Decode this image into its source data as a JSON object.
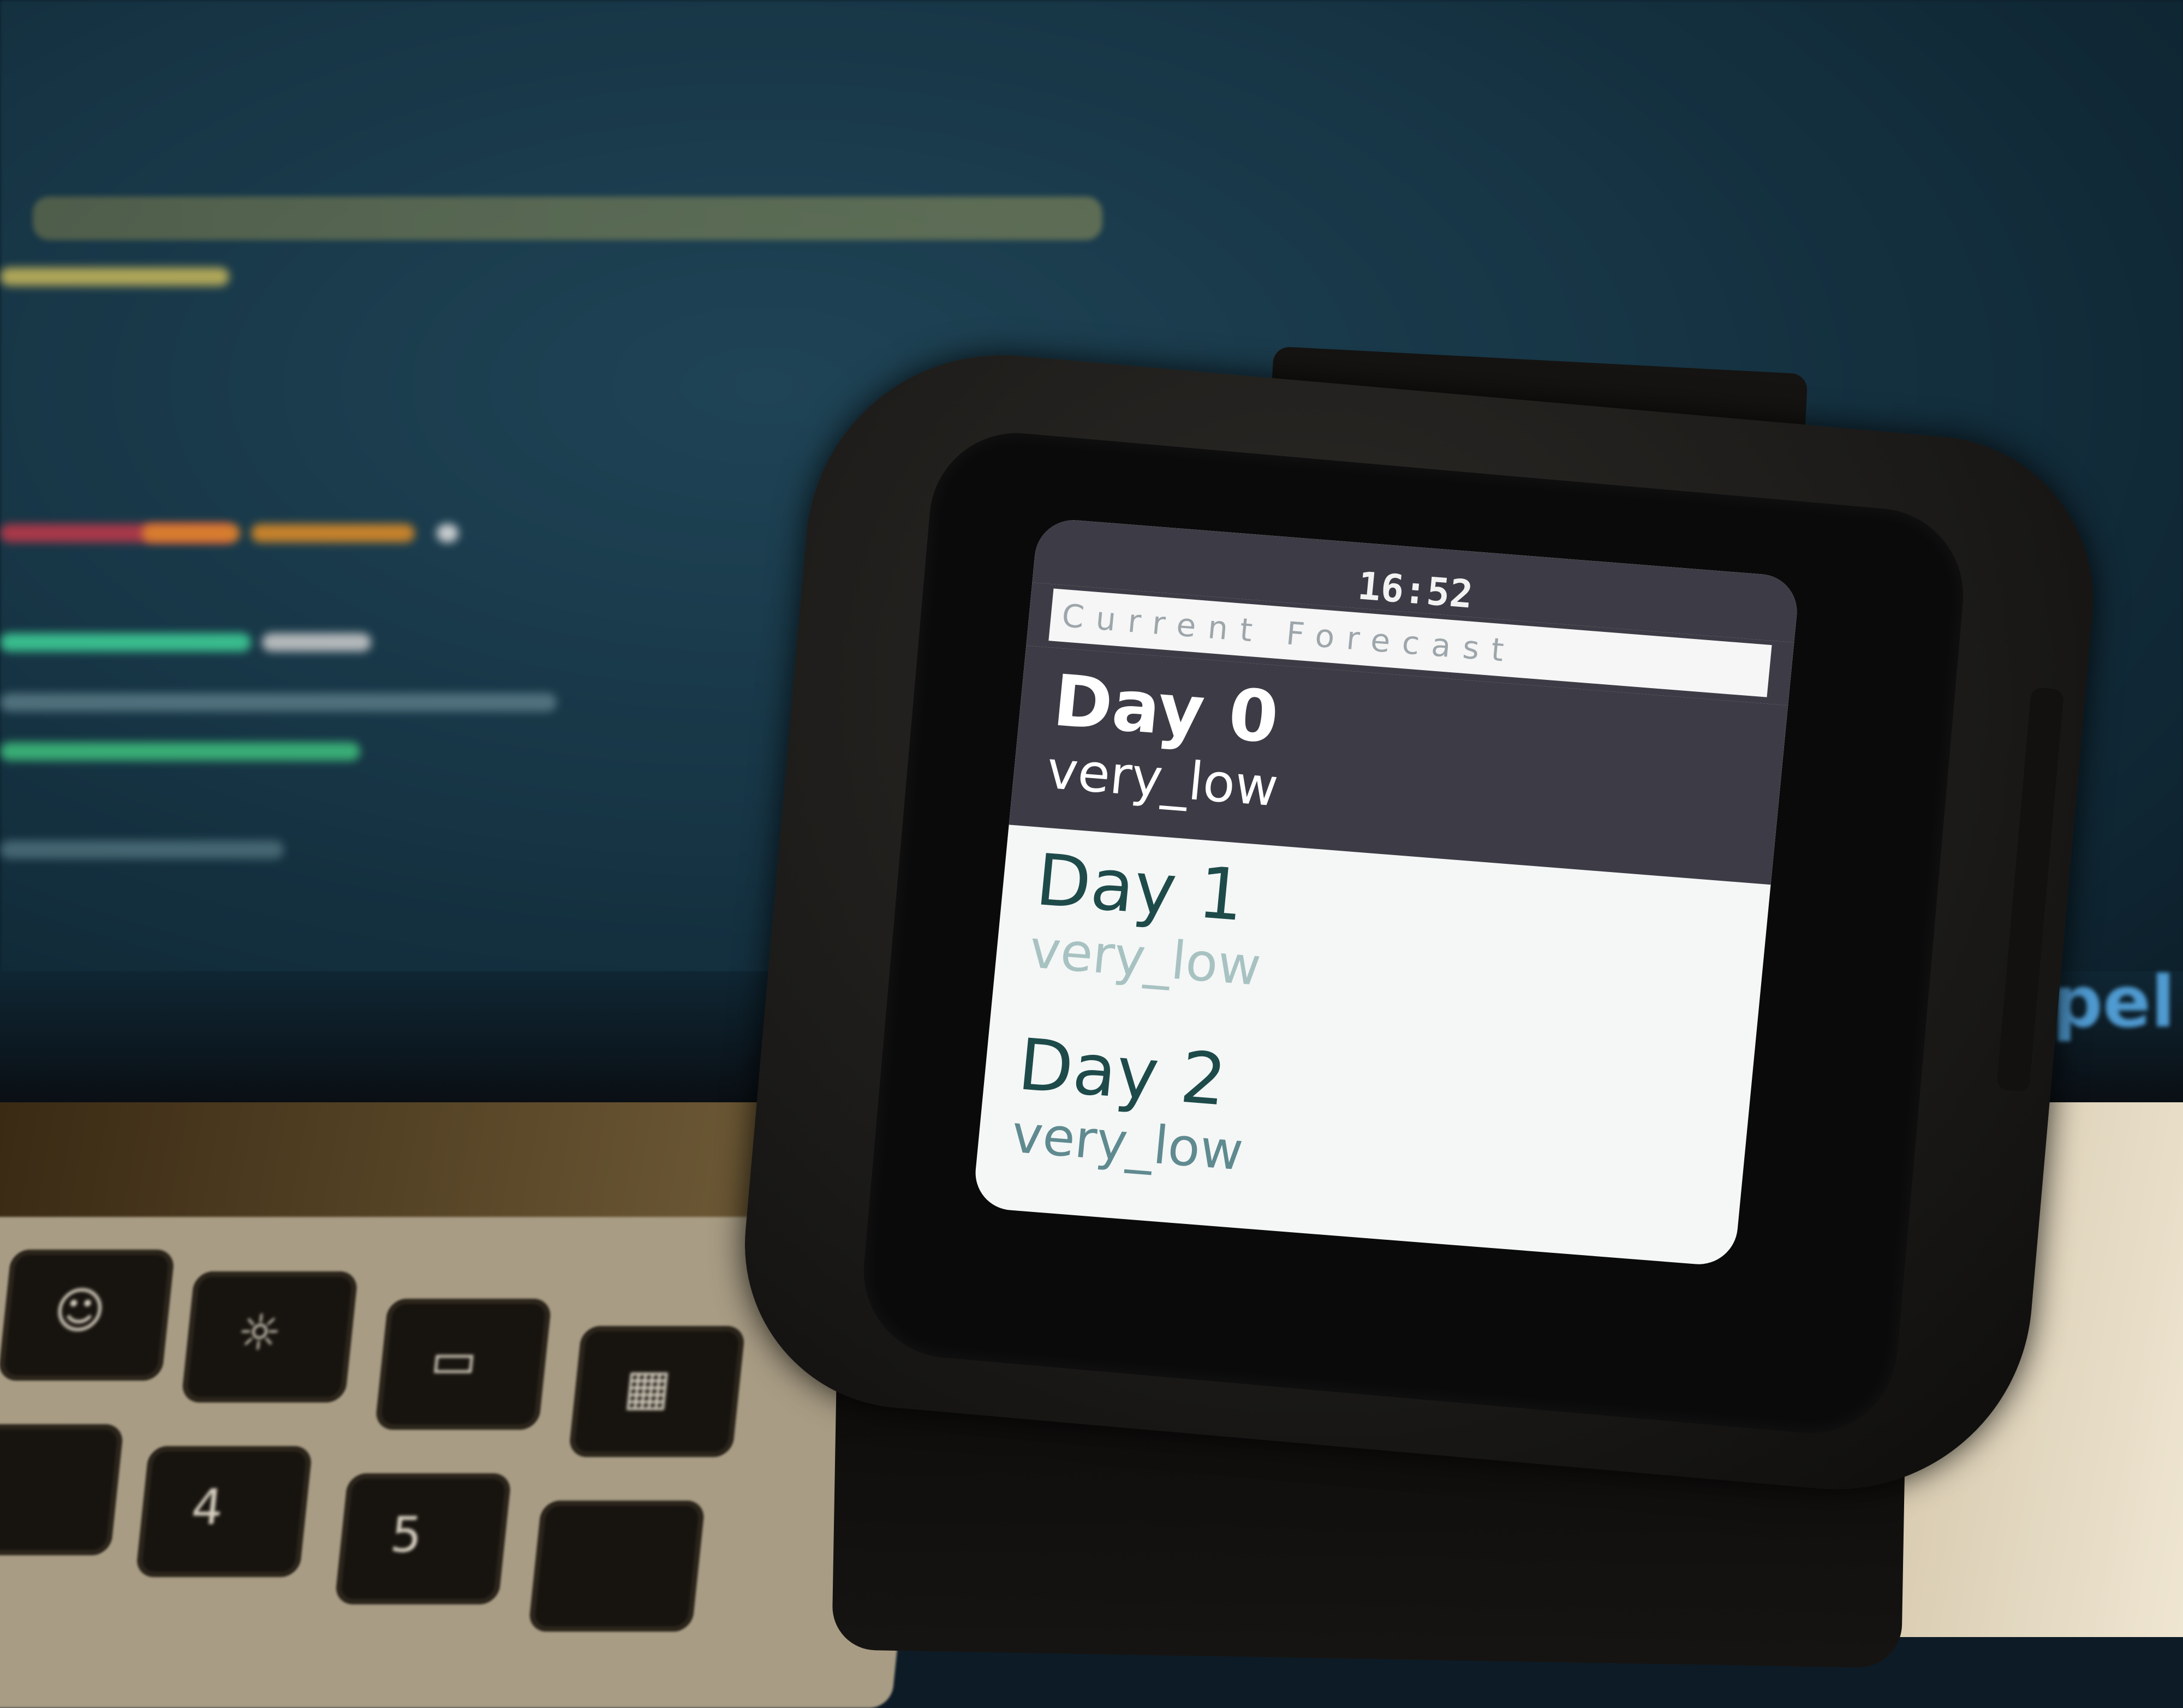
{
  "watch": {
    "status_time": "16:52",
    "header": "Current Forecast",
    "menu_items": [
      {
        "title": "Day 0",
        "subtitle": "very_low",
        "selected": true
      },
      {
        "title": "Day 1",
        "subtitle": "very_low",
        "selected": false
      },
      {
        "title": "Day 2",
        "subtitle": "very_low",
        "selected": false
      }
    ]
  },
  "colors": {
    "screen_bg": "#f4f7f6",
    "selection_bg": "#3d3c46",
    "header_text": "#9da6ab",
    "item_title": "#1e4a4a",
    "desk_light": "#efe6d2",
    "monitor_bg": "#163444"
  }
}
